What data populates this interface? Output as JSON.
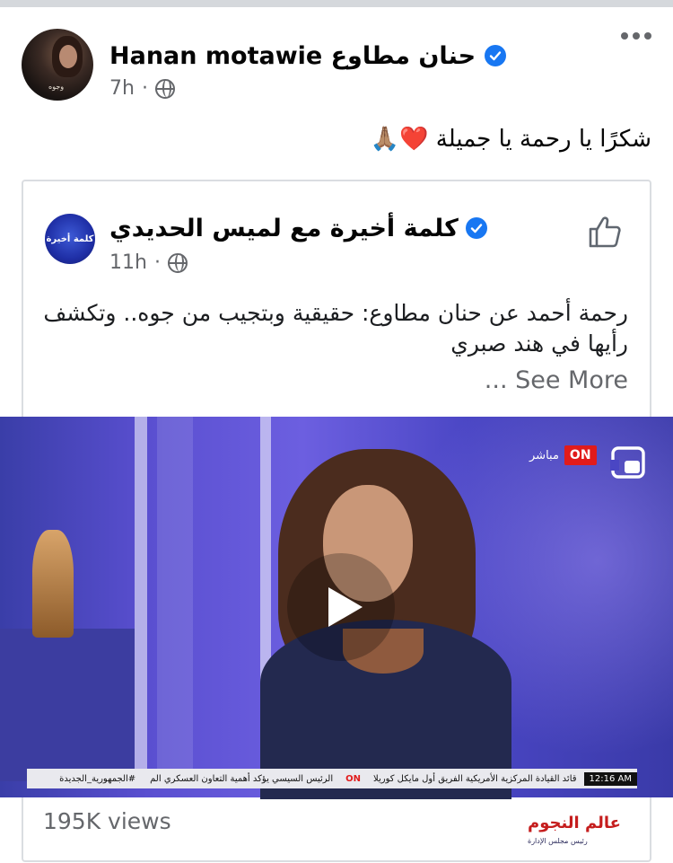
{
  "post": {
    "author": "Hanan motawie حنان مطاوع",
    "time": "7h",
    "dot": "·",
    "text": "شكرًا يا رحمة يا جميلة ❤️🙏🏽",
    "avatar_caption": "وجوه"
  },
  "shared_post": {
    "author": "كلمة  أخيرة  مع لميس  الحديدي",
    "time": "11h",
    "dot": "·",
    "body": "رحمة أحمد عن حنان مطاوع: حقيقية وبتجيب من جوه.. وتكشف رأيها في هند صبري",
    "see_more": "... See More",
    "avatar_caption": "كلمة أخيرة"
  },
  "video": {
    "channel_logo": "ON",
    "live_label": "مباشر",
    "ticker_time": "12:16 AM",
    "ticker_items": [
      "قائد القيادة المركزية الأمريكية الفريق أول مايكل كوريلا",
      "الرئيس السيسي يؤكد أهمية التعاون العسكري الم",
      "#الجمهورية_الجديدة"
    ],
    "ticker_channel": "ON"
  },
  "views": "195K views",
  "watermark": {
    "text": "عالم النجوم",
    "sub": "رئيس مجلس الإدارة"
  },
  "colors": {
    "verified": "#1877f2",
    "secondary_text": "#65676b",
    "card_border": "#dadde1",
    "on_red": "#e11b1b"
  }
}
